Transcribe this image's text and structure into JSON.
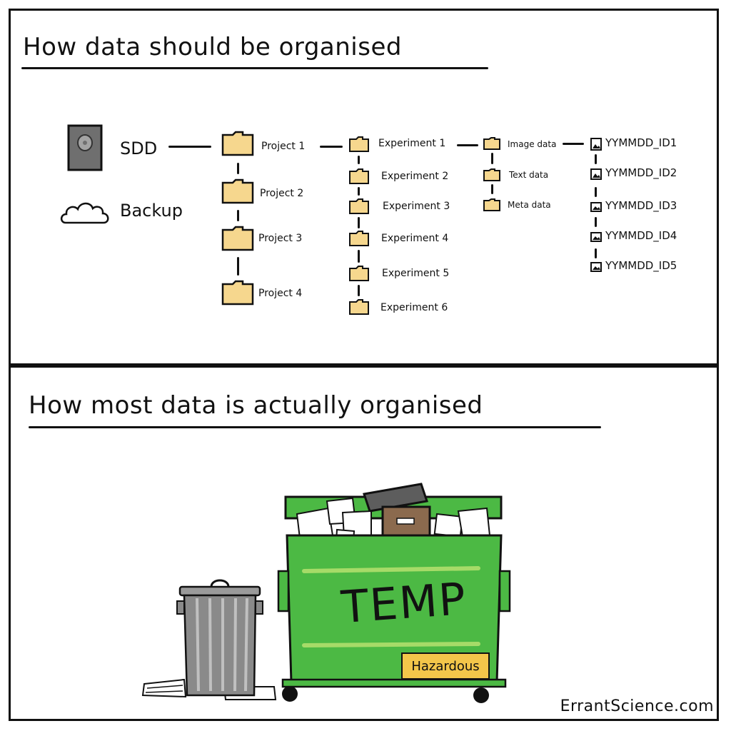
{
  "titles": {
    "top": "How data should be organised",
    "bottom": "How most data is actually organised"
  },
  "storage": {
    "drive_label": "SDD",
    "backup_label": "Backup",
    "drive_icon": "hard-drive-icon",
    "backup_icon": "cloud-icon"
  },
  "projects": [
    "Project 1",
    "Project 2",
    "Project 3",
    "Project 4"
  ],
  "experiments": [
    "Experiment 1",
    "Experiment 2",
    "Experiment 3",
    "Experiment 4",
    "Experiment 5",
    "Experiment 6"
  ],
  "data_folders": [
    "Image data",
    "Text data",
    "Meta data"
  ],
  "files": [
    "YYMMDD_ID1",
    "YYMMDD_ID2",
    "YYMMDD_ID3",
    "YYMMDD_ID4",
    "YYMMDD_ID5"
  ],
  "dumpster": {
    "label": "TEMP",
    "warning": "Hazardous"
  },
  "credit": "ErrantScience.com",
  "colors": {
    "folder": "#f6d78e",
    "dumpster": "#4cb944",
    "dumpster_stripe": "#a6db68",
    "bin": "#8a8a8a",
    "warning": "#f3c64a",
    "box": "#8b6a4e"
  }
}
